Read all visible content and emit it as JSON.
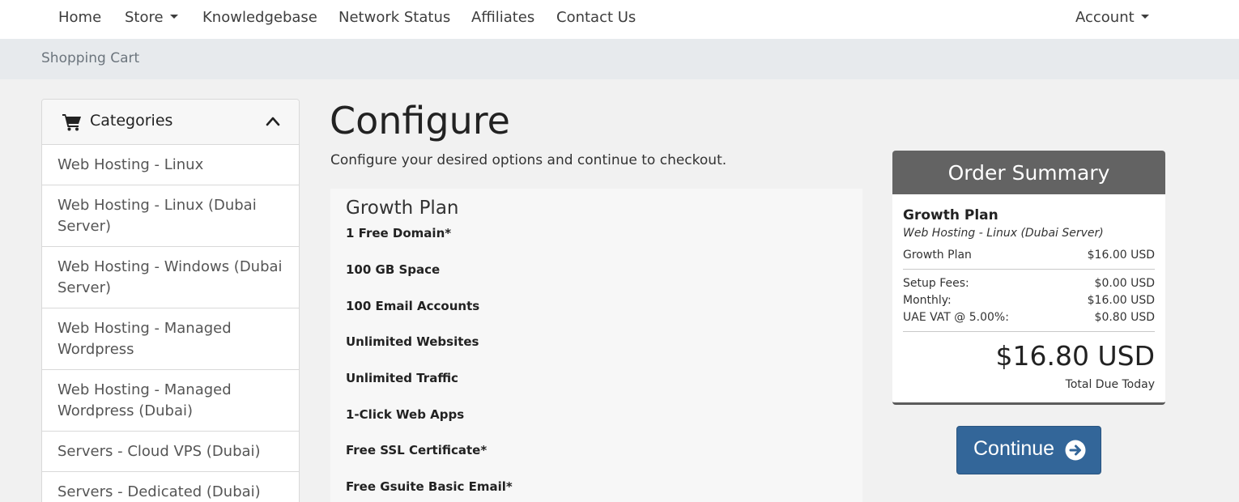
{
  "nav": {
    "items": [
      {
        "label": "Home"
      },
      {
        "label": "Store"
      },
      {
        "label": "Knowledgebase"
      },
      {
        "label": "Network Status"
      },
      {
        "label": "Affiliates"
      },
      {
        "label": "Contact Us"
      }
    ],
    "account_label": "Account"
  },
  "breadcrumb": {
    "current": "Shopping Cart"
  },
  "sidebar": {
    "title": "Categories",
    "categories": [
      "Web Hosting - Linux",
      "Web Hosting - Linux (Dubai Server)",
      "Web Hosting - Windows (Dubai Server)",
      "Web Hosting - Managed Wordpress",
      "Web Hosting - Managed Wordpress (Dubai)",
      "Servers - Cloud VPS (Dubai)",
      "Servers - Dedicated (Dubai)"
    ]
  },
  "main": {
    "title": "Configure",
    "subtitle": "Configure your desired options and continue to checkout.",
    "product": {
      "name": "Growth Plan",
      "features": [
        "1 Free Domain*",
        "100 GB Space",
        "100 Email Accounts",
        "Unlimited Websites",
        "Unlimited Traffic",
        "1-Click Web Apps",
        "Free SSL Certificate*",
        "Free Gsuite Basic Email*"
      ]
    }
  },
  "summary": {
    "title": "Order Summary",
    "product_name": "Growth Plan",
    "product_group": "Web Hosting - Linux (Dubai Server)",
    "line_item": {
      "label": "Growth Plan",
      "value": "$16.00 USD"
    },
    "fees": [
      {
        "label": "Setup Fees:",
        "value": "$0.00 USD"
      },
      {
        "label": "Monthly:",
        "value": "$16.00 USD"
      },
      {
        "label": "UAE VAT @ 5.00%:",
        "value": "$0.80 USD"
      }
    ],
    "total": "$16.80 USD",
    "total_label": "Total Due Today"
  },
  "continue_label": "Continue",
  "colors": {
    "primary_button": "#336699",
    "summary_header": "#636363",
    "breadcrumb_bar": "#e7eaed"
  }
}
